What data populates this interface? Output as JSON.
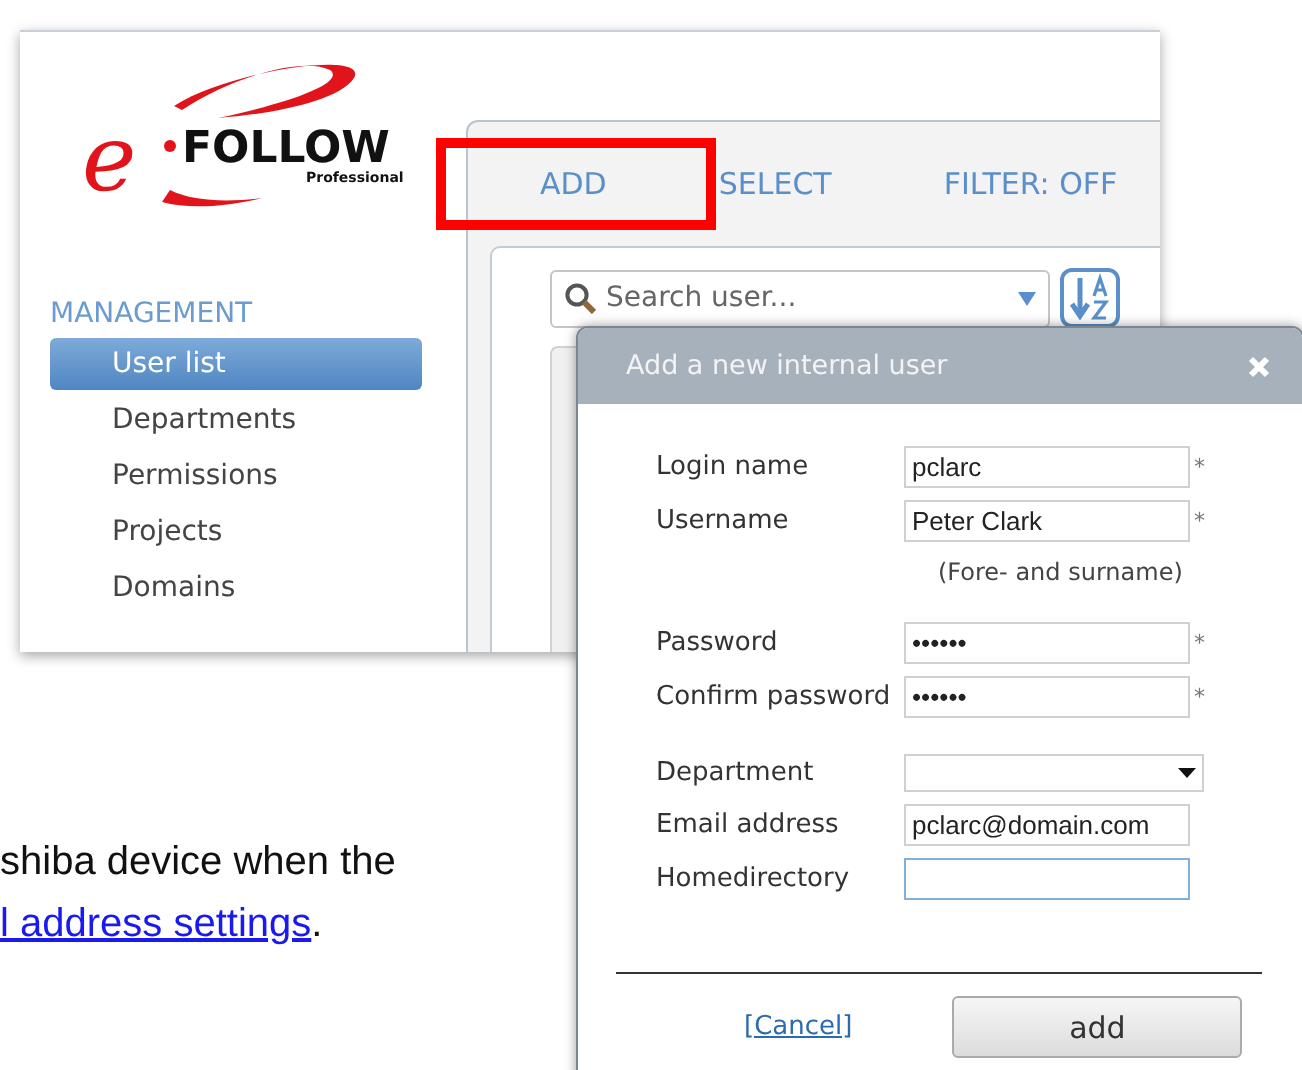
{
  "logo": {
    "letter": "e",
    "name": "FOLLOW",
    "edition": "Professional"
  },
  "sidebar": {
    "heading": "MANAGEMENT",
    "items": [
      {
        "label": "User list",
        "selected": true
      },
      {
        "label": "Departments",
        "selected": false
      },
      {
        "label": "Permissions",
        "selected": false
      },
      {
        "label": "Projects",
        "selected": false
      },
      {
        "label": "Domains",
        "selected": false
      }
    ]
  },
  "tabs": [
    {
      "label": "ADD",
      "highlighted": true
    },
    {
      "label": "SELECT",
      "highlighted": false
    },
    {
      "label": "FILTER: OFF",
      "highlighted": false
    }
  ],
  "search": {
    "placeholder": "Search user..."
  },
  "dialog": {
    "title": "Add a new internal user",
    "groups": [
      [
        {
          "kind": "text",
          "label": "Login name",
          "value": "pclarc",
          "mark": "*",
          "focused": false
        },
        {
          "kind": "text",
          "label": "Username",
          "value": "Peter Clark",
          "mark": "*",
          "focused": false
        },
        {
          "kind": "hint",
          "text": "(Fore- and surname)"
        }
      ],
      [
        {
          "kind": "text",
          "label": "Password",
          "value": "••••••",
          "mark": "*",
          "focused": false
        },
        {
          "kind": "text",
          "label": "Confirm password",
          "value": "••••••",
          "mark": "*",
          "focused": false
        }
      ],
      [
        {
          "kind": "select",
          "label": "Department",
          "focused": false
        },
        {
          "kind": "text",
          "label": "Email address",
          "value": "pclarc@domain.com",
          "focused": false
        },
        {
          "kind": "text",
          "label": "Homedirectory",
          "focused": true
        }
      ]
    ],
    "cancel": "[Cancel]",
    "submit": "add"
  },
  "doc": {
    "line": "shiba device when the",
    "link": "l address settings",
    "after": "."
  }
}
